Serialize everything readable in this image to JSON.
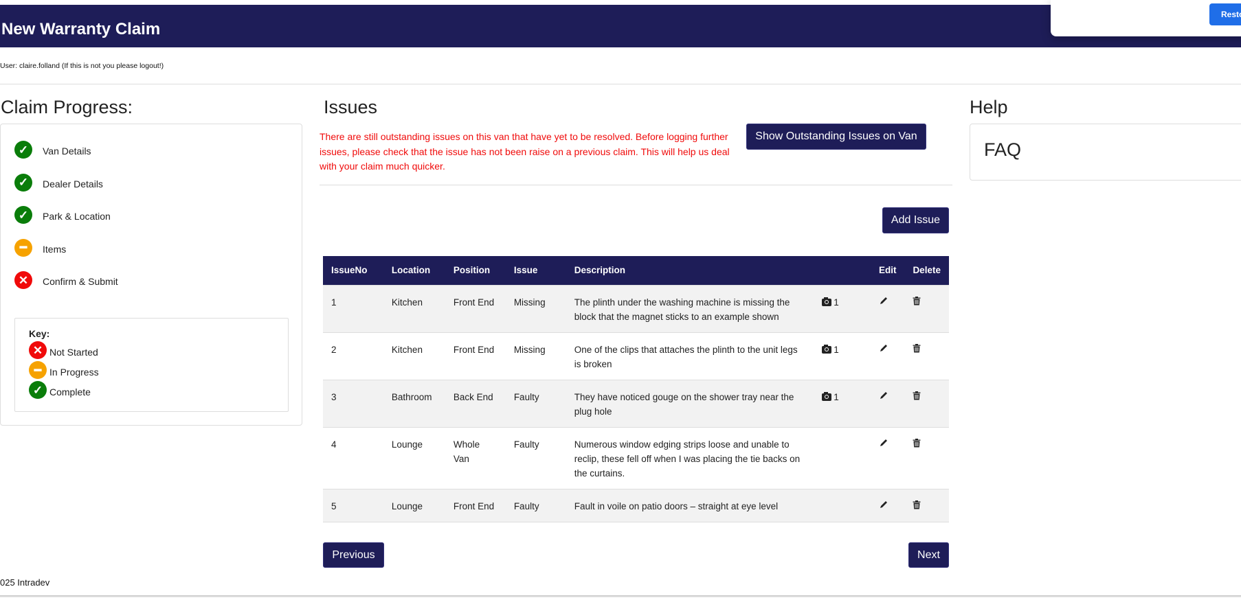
{
  "header": {
    "title": "New Warranty Claim"
  },
  "popup": {
    "restore_label": "Resto"
  },
  "user_line": "User: claire.folland (If this is not you please logout!)",
  "progress": {
    "heading": "Claim Progress:",
    "steps": [
      {
        "label": "Van Details",
        "status": "complete"
      },
      {
        "label": "Dealer Details",
        "status": "complete"
      },
      {
        "label": "Park & Location",
        "status": "complete"
      },
      {
        "label": "Items",
        "status": "in-progress"
      },
      {
        "label": "Confirm & Submit",
        "status": "not-started"
      }
    ],
    "key": {
      "title": "Key:",
      "items": [
        "Not Started",
        "In Progress",
        "Complete"
      ]
    }
  },
  "issues": {
    "heading": "Issues",
    "warning": "There are still outstanding issues on this van that have yet to be resolved. Before logging further issues, please check that the issue has not been raise on a previous claim. This will help us deal with your claim much quicker.",
    "show_outstanding_label": "Show Outstanding Issues on Van",
    "add_issue_label": "Add Issue",
    "columns": [
      "IssueNo",
      "Location",
      "Position",
      "Issue",
      "Description",
      "",
      "Edit",
      "Delete"
    ],
    "rows": [
      {
        "no": "1",
        "location": "Kitchen",
        "position": "Front End",
        "issue": "Missing",
        "description": "The plinth under the washing machine is missing the block that the magnet sticks to an example shown",
        "photos": "1"
      },
      {
        "no": "2",
        "location": "Kitchen",
        "position": "Front End",
        "issue": "Missing",
        "description": "One of the clips that attaches the plinth to the unit legs is broken",
        "photos": "1"
      },
      {
        "no": "3",
        "location": "Bathroom",
        "position": "Back End",
        "issue": "Faulty",
        "description": "They have noticed gouge on the shower tray near the plug hole",
        "photos": "1"
      },
      {
        "no": "4",
        "location": "Lounge",
        "position": "Whole Van",
        "issue": "Faulty",
        "description": "Numerous window edging strips loose and unable to reclip, these fell off when I was placing the tie backs on the curtains.",
        "photos": null
      },
      {
        "no": "5",
        "location": "Lounge",
        "position": "Front End",
        "issue": "Faulty",
        "description": "Fault in voile on patio doors – straight at eye level",
        "photos": null
      }
    ],
    "previous_label": "Previous",
    "next_label": "Next"
  },
  "help": {
    "heading": "Help",
    "faq": "FAQ"
  },
  "footer": "025 Intradev"
}
